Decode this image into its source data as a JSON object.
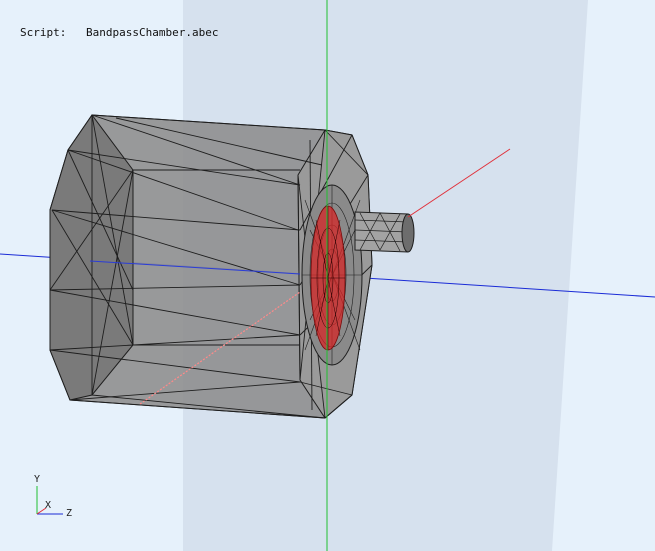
{
  "script": {
    "label": "Script:",
    "filename": "BandpassChamber.abec"
  },
  "triad": {
    "x_label": "X",
    "y_label": "Y",
    "z_label": "Z"
  },
  "colors": {
    "background": "#e6f1fb",
    "plane": "#d6e1ee",
    "mesh_fill": "#8f8f8f",
    "mesh_edge": "#1e1e1e",
    "driver_red": "#d42626",
    "axis_x": "#e0303a",
    "axis_y": "#20c030",
    "axis_z": "#1a2bd6"
  },
  "icons": [
    "axis-triad-icon"
  ]
}
